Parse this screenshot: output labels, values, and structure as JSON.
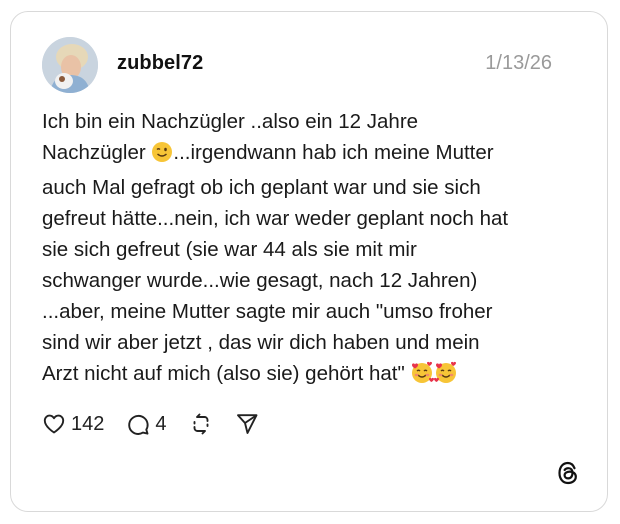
{
  "post": {
    "username": "zubbel72",
    "date": "1/13/26",
    "text_lines": [
      "Ich bin ein Nachzügler ..also ein 12 Jahre",
      "Nachzügler",
      "...irgendwann hab ich meine Mutter",
      "auch Mal gefragt ob ich geplant war und sie sich",
      "gefreut hätte...nein, ich war weder geplant noch hat",
      "sie sich gefreut (sie war 44 als sie mit mir",
      "schwanger wurde...wie gesagt, nach 12 Jahren)",
      "...aber, meine Mutter sagte mir auch \"umso froher",
      "sind wir aber jetzt , das wir dich haben und mein",
      "Arzt nicht auf mich (also sie) gehört hat\""
    ],
    "emojis": [
      "winking-face",
      "smiling-face-with-hearts",
      "smiling-face-with-hearts"
    ]
  },
  "actions": {
    "likes": "142",
    "replies": "4"
  },
  "icons": {
    "like": "heart-icon",
    "reply": "comment-icon",
    "repost": "repost-icon",
    "share": "send-icon",
    "brand": "threads-logo-icon"
  },
  "colors": {
    "text": "#1a1a1a",
    "muted": "#9a9a9a",
    "border": "#d9d9d9"
  }
}
